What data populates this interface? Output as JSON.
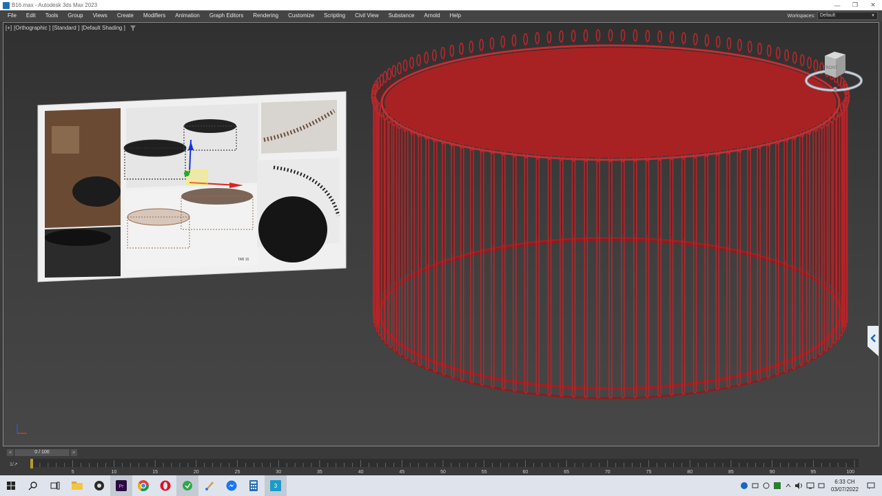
{
  "window": {
    "title": "B16.max - Autodesk 3ds Max 2023",
    "controls": [
      "—",
      "❐",
      "✕"
    ]
  },
  "menu": {
    "items": [
      "File",
      "Edit",
      "Tools",
      "Group",
      "Views",
      "Create",
      "Modifiers",
      "Animation",
      "Graph Editors",
      "Rendering",
      "Customize",
      "Scripting",
      "Civil View",
      "Substance",
      "Arnold",
      "Help"
    ]
  },
  "workspaces": {
    "label": "Workspaces:",
    "value": "Default"
  },
  "viewport": {
    "labels": [
      "[+]",
      "[Orthographic ]",
      "[Standard ]",
      "[Default Shading ]"
    ],
    "viewcube_face": "FRONT",
    "reference_image_text": "TAB 16",
    "object_color": "#a82224",
    "background_color": "#3b3b3b"
  },
  "timeline": {
    "current_frame": "0 / 100",
    "prev_arrow": "<",
    "next_arrow": ">",
    "ticks": [
      "5",
      "10",
      "15",
      "20",
      "25",
      "30",
      "35",
      "40",
      "45",
      "50",
      "55",
      "60",
      "65",
      "70",
      "75",
      "80",
      "85",
      "90",
      "95",
      "100"
    ],
    "mini_icon": "1/↗"
  },
  "taskbar": {
    "time": "6:33 CH",
    "date": "03/07/2022",
    "apps": [
      "windows-start",
      "search",
      "task-view",
      "file-explorer",
      "obs",
      "premiere",
      "chrome",
      "opera",
      "zalo",
      "paint",
      "messenger",
      "calculator",
      "3dsmax"
    ]
  }
}
